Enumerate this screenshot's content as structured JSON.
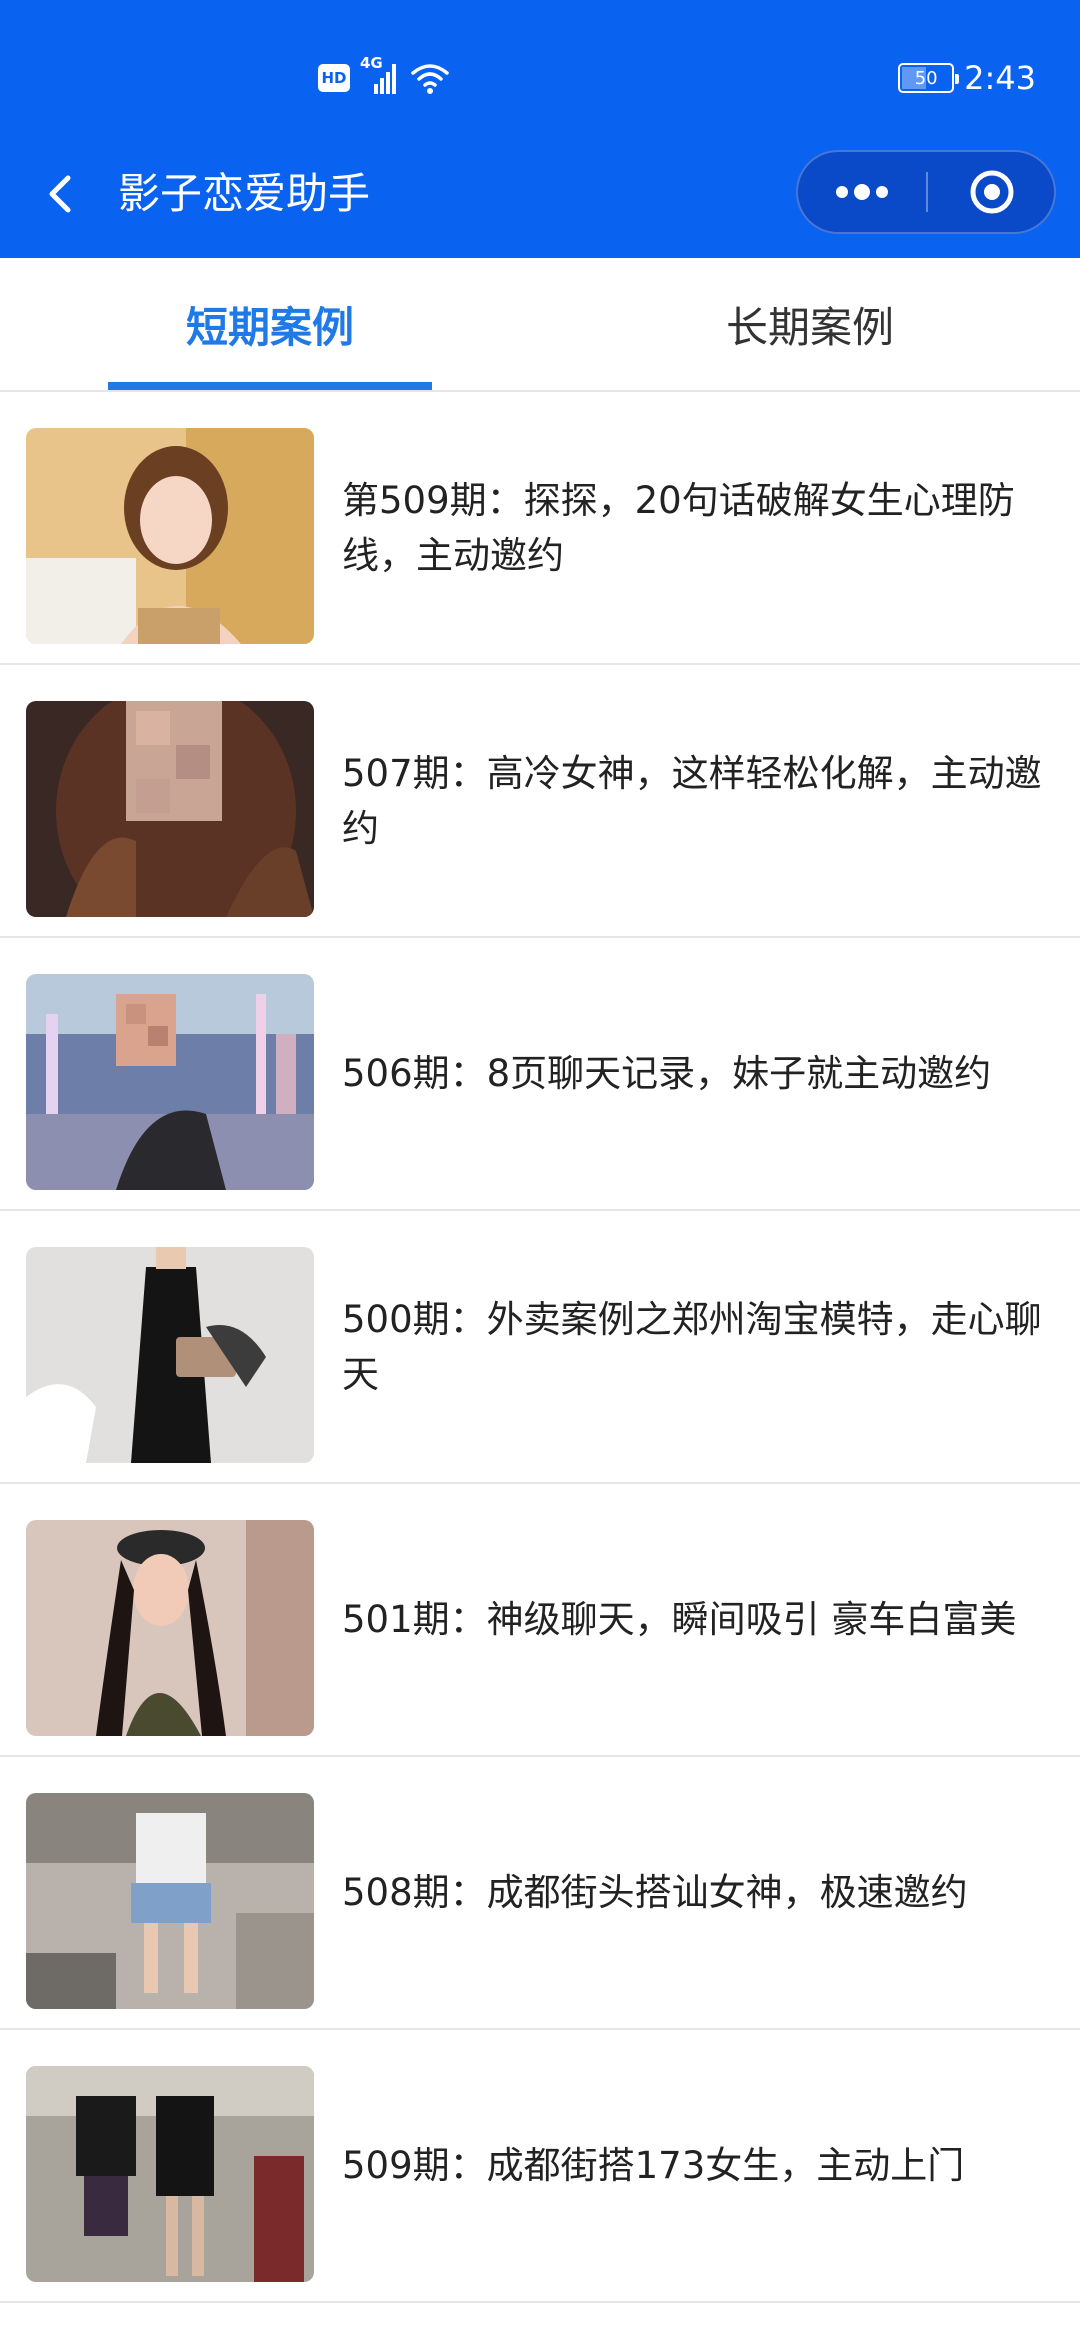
{
  "status_bar": {
    "hd": "HD",
    "network": "4G",
    "battery": "50",
    "battery_level": 0.5,
    "time": "2:43"
  },
  "header": {
    "title": "影子恋爱助手",
    "back_icon": "chevron-left-icon",
    "more_icon": "more-dots-icon",
    "close_icon": "target-close-icon"
  },
  "tabs": [
    {
      "label": "短期案例",
      "active": true
    },
    {
      "label": "长期案例",
      "active": false
    }
  ],
  "colors": {
    "header_bg": "#0a62f0",
    "accent": "#1f7ae8",
    "text": "#222222"
  },
  "cases": [
    {
      "title": "第509期：探探，20句话破解女生心理防线，主动邀约",
      "thumbnail": "photo"
    },
    {
      "title": "507期：高冷女神，这样轻松化解，主动邀约",
      "thumbnail": "photo"
    },
    {
      "title": "506期：8页聊天记录，妹子就主动邀约",
      "thumbnail": "photo"
    },
    {
      "title": "500期：外卖案例之郑州淘宝模特，走心聊天",
      "thumbnail": "photo"
    },
    {
      "title": "501期：神级聊天，瞬间吸引 豪车白富美",
      "thumbnail": "photo"
    },
    {
      "title": "508期：成都街头搭讪女神，极速邀约",
      "thumbnail": "photo"
    },
    {
      "title": "509期：成都街搭173女生，主动上门",
      "thumbnail": "photo"
    }
  ]
}
